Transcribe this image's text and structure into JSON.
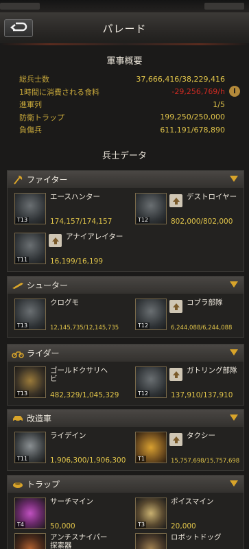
{
  "header": {
    "title": "パレード"
  },
  "overview": {
    "title": "軍事概要",
    "rows": [
      {
        "label": "総兵士数",
        "value": "37,666,416/38,229,416"
      },
      {
        "label": "1時間に消費される食料",
        "value": "-29,256,769/h"
      },
      {
        "label": "進軍列",
        "value": "1/5"
      },
      {
        "label": "防衛トラップ",
        "value": "199,250/250,000"
      },
      {
        "label": "負傷兵",
        "value": "611,191/678,890"
      }
    ]
  },
  "soldier_section": {
    "title": "兵士データ"
  },
  "categories": [
    {
      "title": "ファイター",
      "icon": "axe-icon",
      "units": [
        {
          "name": "エースハンター",
          "tier": "T13",
          "count": "174,157/174,157",
          "upgrade": false
        },
        {
          "name": "デストロイヤー",
          "tier": "T12",
          "count": "802,000/802,000",
          "upgrade": true
        },
        {
          "name": "アナイアレイター",
          "tier": "T11",
          "count": "16,199/16,199",
          "upgrade": true
        }
      ]
    },
    {
      "title": "シューター",
      "icon": "rifle-icon",
      "units": [
        {
          "name": "クログモ",
          "tier": "T13",
          "count": "12,145,735/12,145,735",
          "upgrade": false
        },
        {
          "name": "コブラ部隊",
          "tier": "T12",
          "count": "6,244,088/6,244,088",
          "upgrade": true
        }
      ]
    },
    {
      "title": "ライダー",
      "icon": "motorcycle-icon",
      "units": [
        {
          "name": "ゴールドクサリヘビ",
          "tier": "T13",
          "count": "482,329/1,045,329",
          "upgrade": false
        },
        {
          "name": "ガトリング部隊",
          "tier": "T12",
          "count": "137,910/137,910",
          "upgrade": true
        }
      ]
    },
    {
      "title": "改造車",
      "icon": "car-icon",
      "units": [
        {
          "name": "ライデイン",
          "tier": "T11",
          "count": "1,906,300/1,906,300",
          "upgrade": false
        },
        {
          "name": "タクシー",
          "tier": "T1",
          "count": "15,757,698/15,757,698",
          "upgrade": true
        }
      ]
    },
    {
      "title": "トラップ",
      "icon": "trap-icon",
      "units": [
        {
          "name": "サーチマイン",
          "tier": "T4",
          "count": "50,000",
          "upgrade": false
        },
        {
          "name": "ポイスマイン",
          "tier": "T3",
          "count": "20,000",
          "upgrade": false
        },
        {
          "name": "アンチスナイパー探索器",
          "tier": "",
          "count": "",
          "upgrade": false
        },
        {
          "name": "ロボットドッグ",
          "tier": "",
          "count": "",
          "upgrade": false
        }
      ]
    }
  ],
  "colors": {
    "accent_gold": "#e0c44a",
    "label_gold": "#c9a93b",
    "negative_red": "#d02a22",
    "arrow_gold": "#d8a42a"
  }
}
